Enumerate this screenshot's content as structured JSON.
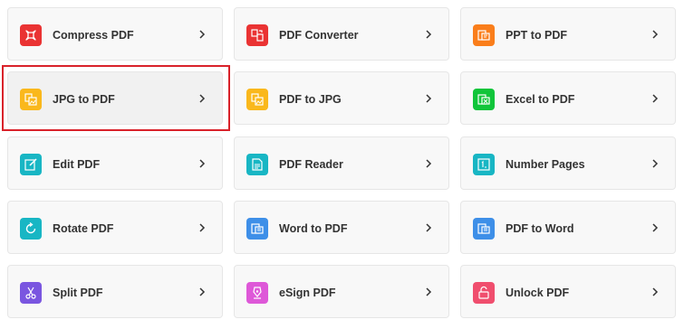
{
  "tools": [
    {
      "label": "Compress PDF",
      "icon": "compress-icon",
      "color": "#ea3333"
    },
    {
      "label": "PDF Converter",
      "icon": "convert-icon",
      "color": "#ea3333"
    },
    {
      "label": "PPT to PDF",
      "icon": "ppt-icon",
      "color": "#fa7e1b"
    },
    {
      "label": "JPG to PDF",
      "icon": "image-icon",
      "color": "#fab81c"
    },
    {
      "label": "PDF to JPG",
      "icon": "image-icon",
      "color": "#fab81c"
    },
    {
      "label": "Excel to PDF",
      "icon": "excel-icon",
      "color": "#10c53a"
    },
    {
      "label": "Edit PDF",
      "icon": "edit-icon",
      "color": "#18b6c4"
    },
    {
      "label": "PDF Reader",
      "icon": "reader-icon",
      "color": "#18b6c4"
    },
    {
      "label": "Number Pages",
      "icon": "number-icon",
      "color": "#18b6c4"
    },
    {
      "label": "Rotate PDF",
      "icon": "rotate-icon",
      "color": "#18b6c4"
    },
    {
      "label": "Word to PDF",
      "icon": "word-icon",
      "color": "#3e8fe8"
    },
    {
      "label": "PDF to Word",
      "icon": "word-icon",
      "color": "#3e8fe8"
    },
    {
      "label": "Split PDF",
      "icon": "scissors-icon",
      "color": "#7a56e0"
    },
    {
      "label": "eSign PDF",
      "icon": "pen-icon",
      "color": "#de58d8"
    },
    {
      "label": "Unlock PDF",
      "icon": "unlock-icon",
      "color": "#f04e6e"
    }
  ],
  "highlighted_tool": "JPG to PDF",
  "highlight_color": "#d9222a"
}
